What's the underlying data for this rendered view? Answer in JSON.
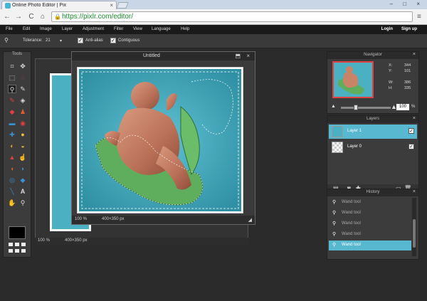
{
  "browser": {
    "tab_title": "Online Photo Editor | Pix",
    "tab_close": "×",
    "window_buttons": "– □ ×",
    "url": "https://pixlr.com/editor/",
    "back": "←",
    "forward": "→",
    "reload": "C",
    "home": "⌂",
    "menu": "≡"
  },
  "menubar": {
    "items": [
      "File",
      "Edit",
      "Image",
      "Layer",
      "Adjustment",
      "Filter",
      "View",
      "Language",
      "Help"
    ],
    "login": "Login",
    "signup": "Sign up"
  },
  "options": {
    "tolerance_label": "Tolerance:",
    "tolerance_value": "21",
    "antialias_label": "Anti-alias",
    "contiguous_label": "Contiguous",
    "antialias_checked": true,
    "contiguous_checked": true
  },
  "tools": {
    "title": "Tools",
    "selected": "magic-wand"
  },
  "document": {
    "title": "Untitled",
    "buttons": "⬒ ×",
    "zoom": "100 %",
    "size": "400×350 px"
  },
  "background_document": {
    "zoom": "100 %",
    "size": "400×350 px"
  },
  "navigator": {
    "title": "Navigator",
    "x_label": "X:",
    "x_value": "344",
    "y_label": "Y:",
    "y_value": "101",
    "w_label": "W:",
    "w_value": "386",
    "h_label": "H:",
    "h_value": "335",
    "zoom": "100",
    "zoom_fraction": 0.3
  },
  "layers": {
    "title": "Layers",
    "items": [
      {
        "label": "Layer 1",
        "selected": true,
        "visible": true
      },
      {
        "label": "Layer 0",
        "selected": false,
        "visible": true
      }
    ]
  },
  "history": {
    "title": "History",
    "items": [
      "Wand tool",
      "Wand tool",
      "Wand tool",
      "Wand tool",
      "Wand tool"
    ],
    "selected_index": 4
  },
  "colors": {
    "accent": "#57b8cf",
    "background": "#2b2b2b",
    "url_green": "#1a8e2e"
  }
}
